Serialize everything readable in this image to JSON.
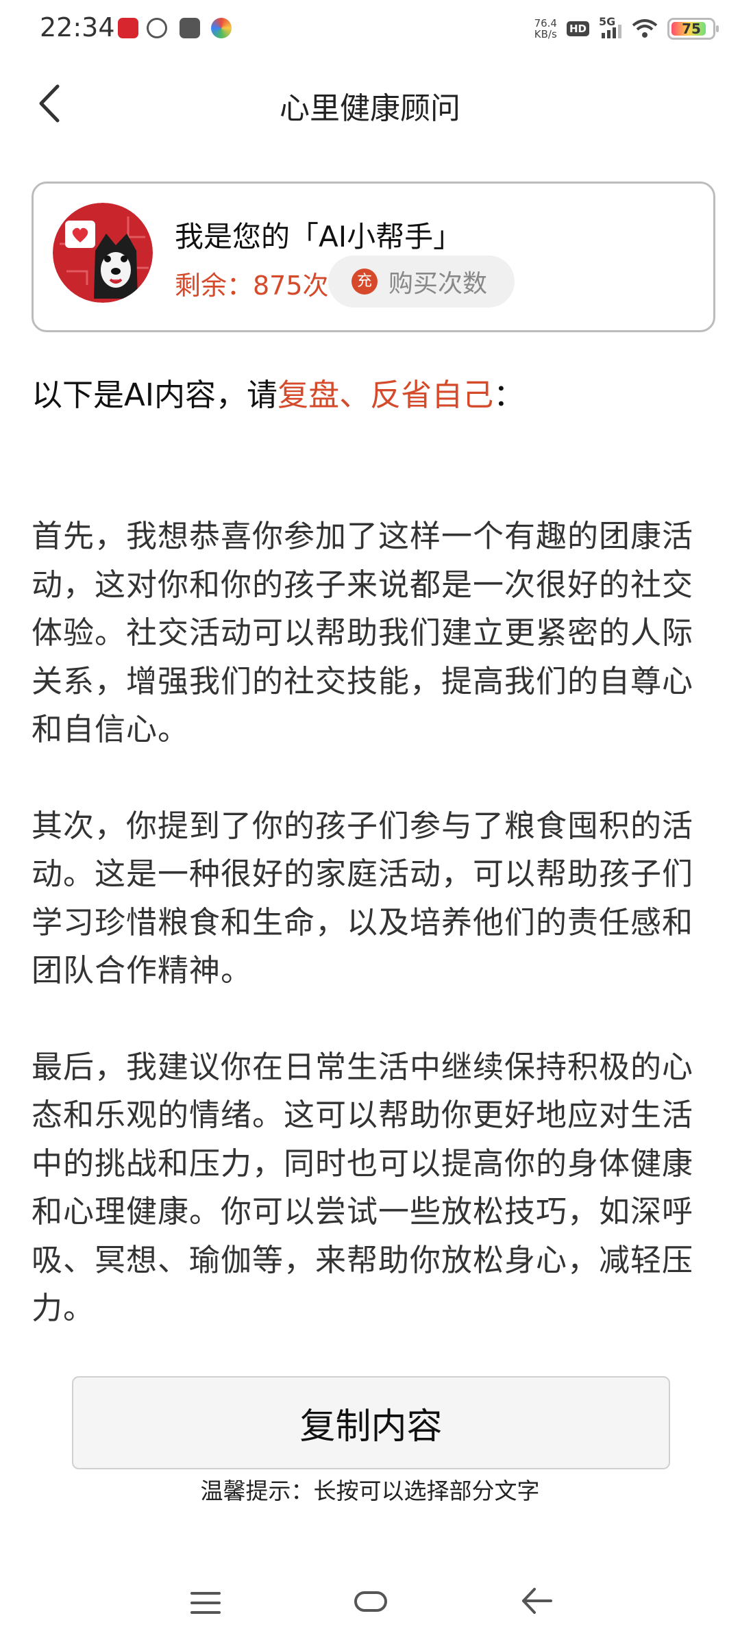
{
  "status_bar": {
    "time": "22:34",
    "net_speed_value": "76.4",
    "net_speed_unit": "KB/s",
    "hd": "HD",
    "network": "5G",
    "battery": "75"
  },
  "header": {
    "title": "心里健康顾问",
    "back_icon": "chevron-left-icon"
  },
  "card": {
    "title": "我是您的「AI小帮手」",
    "remaining": "剩余：875次",
    "buy_icon_char": "充",
    "buy_label": "购买次数"
  },
  "intro": {
    "prefix": "以下是AI内容，请",
    "highlight": "复盘、反省自己",
    "suffix": "："
  },
  "content": {
    "paragraphs": [
      "首先，我想恭喜你参加了这样一个有趣的团康活动，这对你和你的孩子来说都是一次很好的社交体验。社交活动可以帮助我们建立更紧密的人际关系，增强我们的社交技能，提高我们的自尊心和自信心。",
      "其次，你提到了你的孩子们参与了粮食囤积的活动。这是一种很好的家庭活动，可以帮助孩子们学习珍惜粮食和生命，以及培养他们的责任感和团队合作精神。",
      "最后，我建议你在日常生活中继续保持积极的心态和乐观的情绪。这可以帮助你更好地应对生活中的挑战和压力，同时也可以提高你的身体健康和心理健康。你可以尝试一些放松技巧，如深呼吸、冥想、瑜伽等，来帮助你放松身心，减轻压力。"
    ]
  },
  "actions": {
    "copy_label": "复制内容",
    "tip": "温馨提示：长按可以选择部分文字"
  },
  "colors": {
    "accent": "#d44a2a",
    "text": "#333333",
    "border": "#bcbcbc"
  },
  "nav_bar": {
    "menu_icon": "menu-icon",
    "home_icon": "home-icon",
    "back_icon": "back-icon"
  }
}
